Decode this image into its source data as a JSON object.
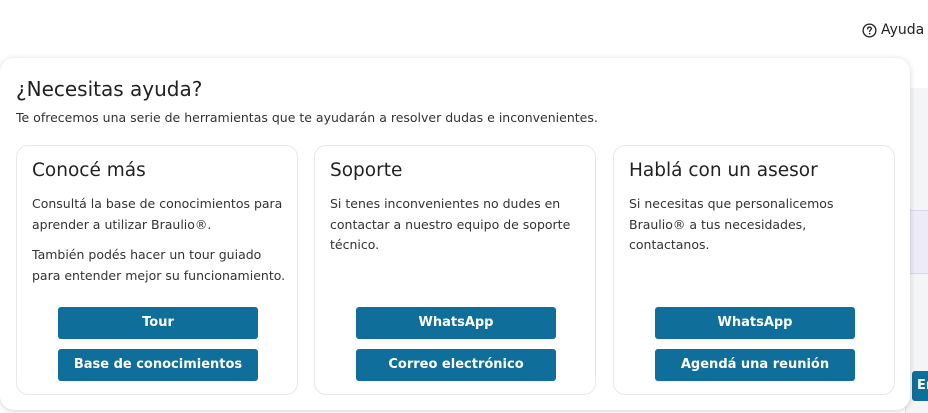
{
  "header": {
    "help_label": "Ayuda"
  },
  "popover": {
    "title": "¿Necesitas ayuda?",
    "subtitle": "Te ofrecemos una serie de herramientas que te ayudarán a resolver dudas e inconvenientes.",
    "cards": [
      {
        "title": "Conocé más",
        "paragraphs": [
          "Consultá la base de conocimientos para aprender a utilizar Braulio®.",
          "También podés hacer un tour guiado para entender mejor su funcionamiento."
        ],
        "buttons": [
          "Tour",
          "Base de conocimientos"
        ]
      },
      {
        "title": "Soporte",
        "paragraphs": [
          "Si tenes inconvenientes no dudes en contactar a nuestro equipo de soporte técnico."
        ],
        "buttons": [
          "WhatsApp",
          "Correo electrónico"
        ]
      },
      {
        "title": "Hablá con un asesor",
        "paragraphs": [
          "Si necesitas que personalicemos Braulio® a tus necesidades, contactanos."
        ],
        "buttons": [
          "WhatsApp",
          "Agendá una reunión"
        ]
      }
    ]
  },
  "background": {
    "partial_button_label": "En"
  },
  "colors": {
    "accent": "#0f6e9a",
    "card_border": "#e6e8ec"
  }
}
